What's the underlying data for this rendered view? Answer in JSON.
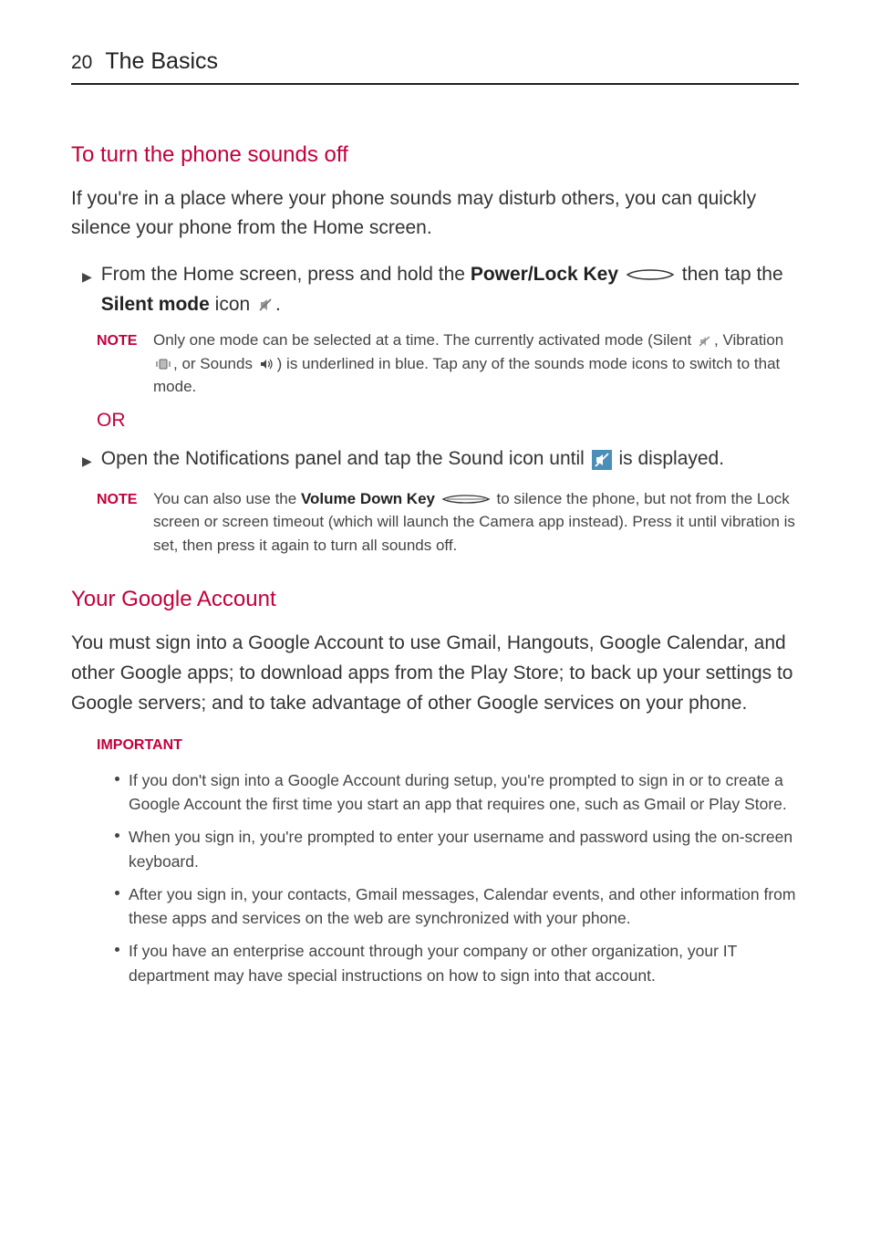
{
  "header": {
    "page_num": "20",
    "chapter": "The Basics"
  },
  "section1": {
    "title": "To turn the phone sounds off",
    "intro": "If you're in a place where your phone sounds may disturb others, you can quickly silence your phone from the Home screen.",
    "step1_a": "From the Home screen, press and hold the ",
    "step1_bold1": "Power/Lock Key",
    "step1_b": " then tap the ",
    "step1_bold2": "Silent mode",
    "step1_c": " icon ",
    "step1_end": ".",
    "note1_label": "NOTE",
    "note1_a": "Only one mode can be selected at a time. The currently activated mode (Silent ",
    "note1_b": ", Vibration ",
    "note1_c": ", or Sounds ",
    "note1_d": ") is underlined in blue. Tap any of the sounds mode icons to switch to that mode.",
    "or": "OR",
    "step2_a": "Open the Notifications panel and tap the Sound icon until ",
    "step2_b": " is displayed.",
    "note2_label": "NOTE",
    "note2_a": "You can also use the ",
    "note2_bold": "Volume Down Key",
    "note2_b": " to silence the phone, but not from the Lock screen or screen timeout (which will launch the Camera app instead). Press it until vibration is set, then press it again to turn all sounds off."
  },
  "section2": {
    "title": "Your Google Account",
    "intro": "You must sign into a Google Account to use Gmail, Hangouts, Google Calendar, and other Google apps; to download apps from the Play Store; to back up your settings to Google servers; and to take advantage of other Google services on your phone.",
    "important_label": "IMPORTANT",
    "items": [
      "If you don't sign into a Google Account during setup, you're prompted to sign in or to create a Google Account the first time you start an app that requires one, such as Gmail or Play Store.",
      "When you sign in, you're prompted to enter your username and password using the on-screen keyboard.",
      "After you sign in, your contacts, Gmail messages, Calendar events, and other information from these apps and services on the web are synchronized with your phone.",
      "If you have an enterprise account through your company or other organization, your IT department may have special instructions on how to sign into that account."
    ]
  }
}
